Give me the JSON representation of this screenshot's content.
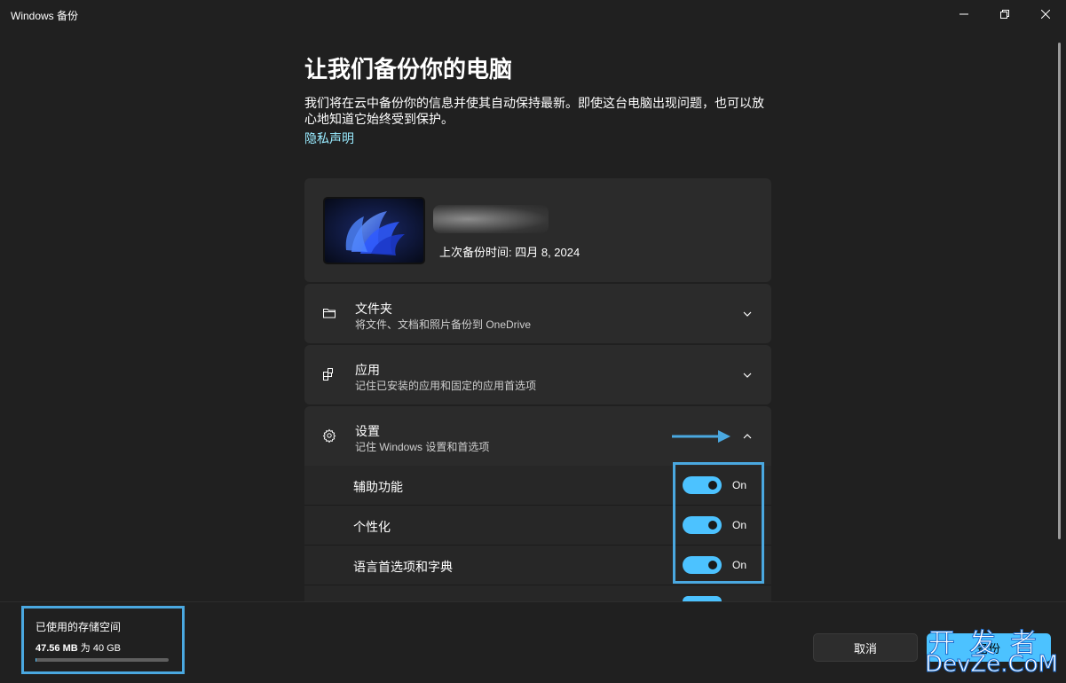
{
  "window": {
    "title": "Windows 备份",
    "controls": {
      "minimize_icon": "minimize-icon",
      "maximize_icon": "restore-icon",
      "close_icon": "close-icon"
    }
  },
  "header": {
    "title": "让我们备份你的电脑",
    "description": "我们将在云中备份你的信息并使其自动保持最新。即使这台电脑出现问题，也可以放心地知道它始终受到保护。",
    "privacy_link": "隐私声明"
  },
  "device": {
    "last_backup": "上次备份时间: 四月 8, 2024"
  },
  "sections": [
    {
      "title": "文件夹",
      "subtitle": "将文件、文档和照片备份到 OneDrive",
      "icon": "folder-icon",
      "expanded": false
    },
    {
      "title": "应用",
      "subtitle": "记住已安装的应用和固定的应用首选项",
      "icon": "apps-icon",
      "expanded": false
    },
    {
      "title": "设置",
      "subtitle": "记住 Windows 设置和首选项",
      "icon": "gear-icon",
      "expanded": true
    }
  ],
  "settings_items": [
    {
      "label": "辅助功能",
      "state": "On"
    },
    {
      "label": "个性化",
      "state": "On"
    },
    {
      "label": "语言首选项和字典",
      "state": "On"
    }
  ],
  "footer": {
    "storage_title": "已使用的存储空间",
    "storage_used": "47.56 MB",
    "storage_sep": "为",
    "storage_total": "40 GB",
    "storage_fraction": 0.001,
    "cancel_label": "取消",
    "backup_label": "备份"
  },
  "watermark": {
    "line1": "开发者",
    "line2": "DevZe.CoM"
  },
  "colors": {
    "accent": "#4cc2ff",
    "link": "#99ebff",
    "annotation": "#4aa8e0",
    "background": "#202020",
    "card": "#2b2b2b"
  }
}
